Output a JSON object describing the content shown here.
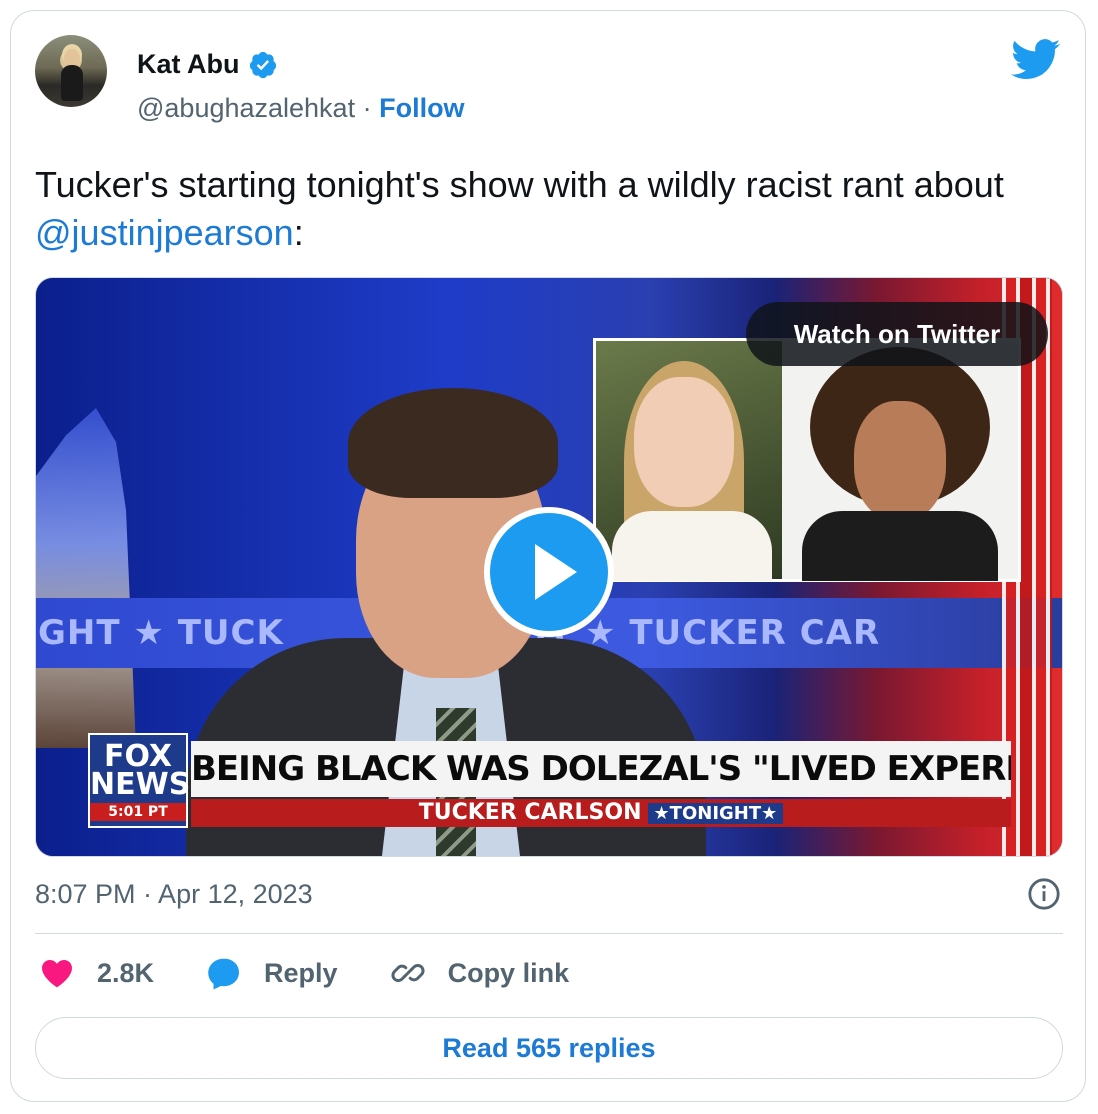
{
  "author": {
    "name": "Kat Abu",
    "handle": "@abughazalehkat",
    "separator": " · ",
    "follow_label": "Follow",
    "verified": true
  },
  "tweet": {
    "text_before": "Tucker's starting tonight's show with a wildly racist rant about ",
    "mention": "@justinjpearson",
    "text_after": ":"
  },
  "media": {
    "watch_label": "Watch on Twitter",
    "strip_left": "GHT  ★  TUCK",
    "strip_mid": "IGHT  ★  TUCKER CAR",
    "logo_line1": "FOX",
    "logo_line2": "NEWS",
    "logo_time": "5:01 PT",
    "headline": "BEING BLACK WAS DOLEZAL'S \"LIVED EXPERIENCE\"",
    "show_name": "TUCKER CARLSON",
    "show_suffix": "★TONIGHT★"
  },
  "meta": {
    "timestamp": "8:07 PM · Apr 12, 2023"
  },
  "actions": {
    "likes": "2.8K",
    "reply_label": "Reply",
    "copy_label": "Copy link"
  },
  "footer": {
    "read_replies": "Read 565 replies"
  },
  "colors": {
    "accent": "#1d7bd6",
    "like": "#f91880",
    "reply": "#1d9bf0",
    "muted": "#536471",
    "border": "#cfd9de"
  },
  "icons": [
    "verified-badge-icon",
    "twitter-bird-icon",
    "play-icon",
    "info-icon",
    "heart-icon",
    "reply-bubble-icon",
    "link-icon"
  ]
}
